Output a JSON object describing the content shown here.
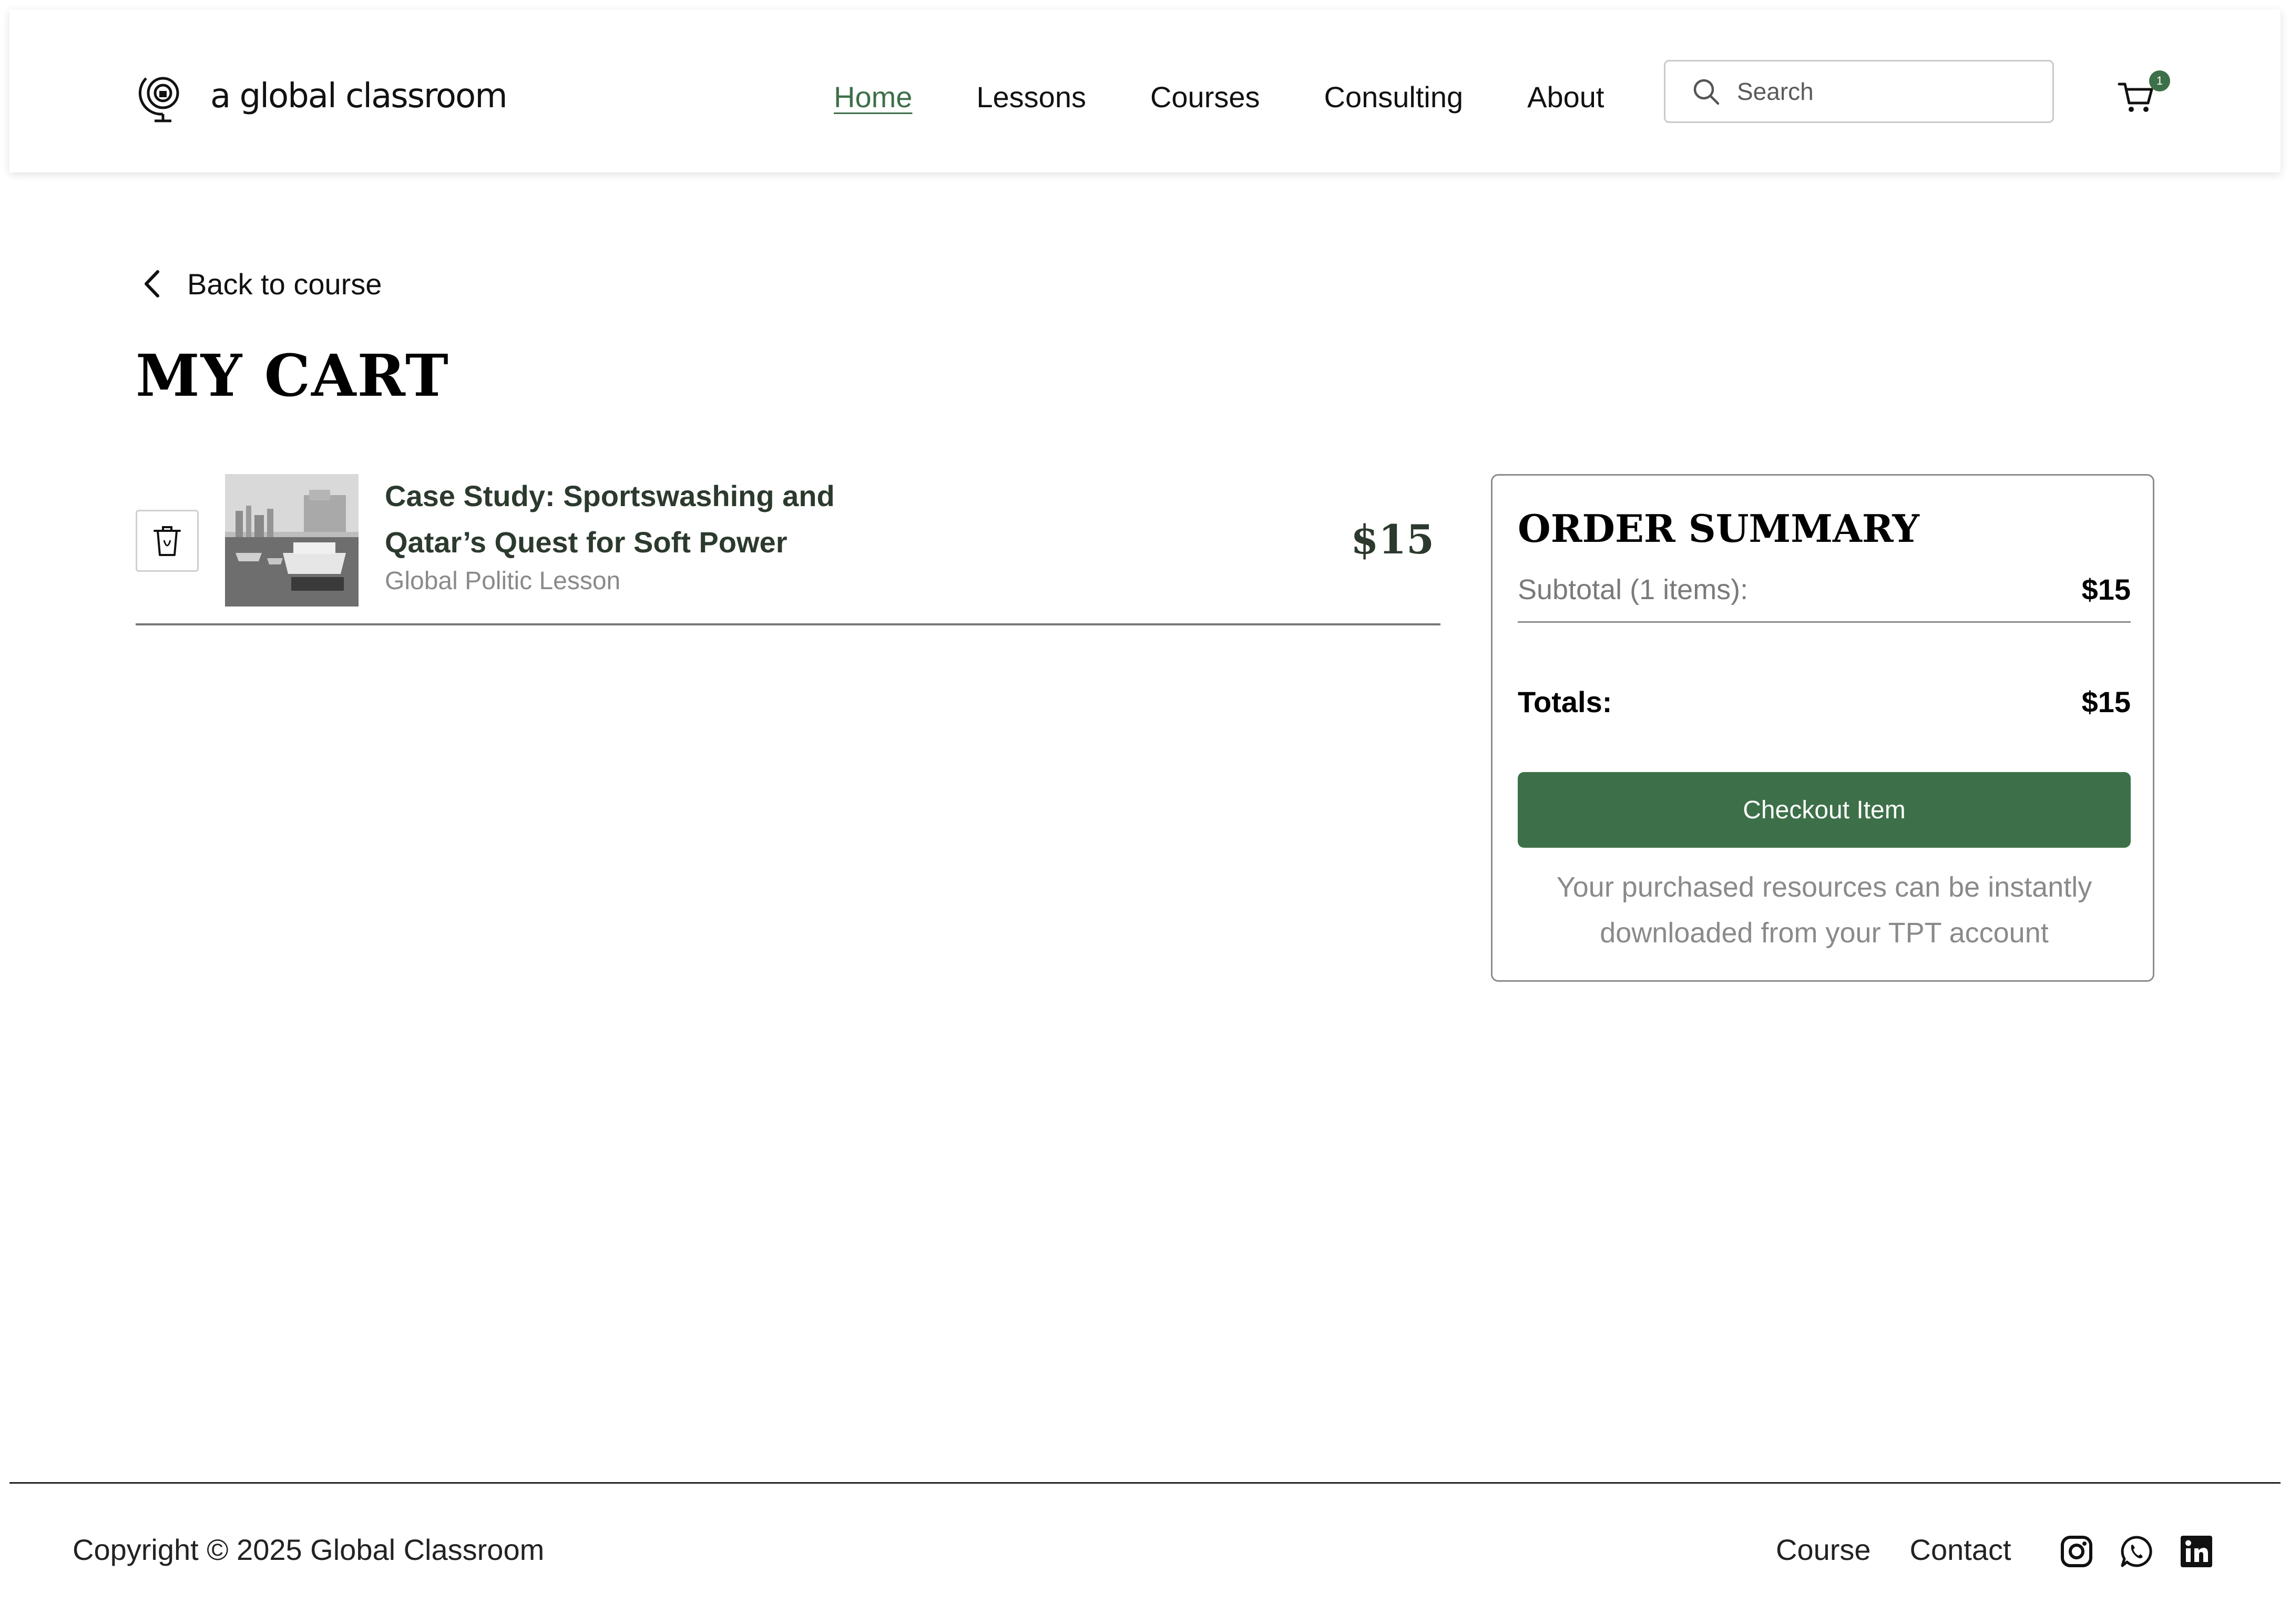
{
  "header": {
    "logo_text": "a global classroom",
    "nav": [
      {
        "label": "Home",
        "active": true
      },
      {
        "label": "Lessons",
        "active": false
      },
      {
        "label": "Courses",
        "active": false
      },
      {
        "label": "Consulting",
        "active": false
      },
      {
        "label": "About",
        "active": false
      }
    ],
    "search_placeholder": "Search",
    "cart_count": "1"
  },
  "back_link": "Back to course",
  "page_title": "MY CART",
  "cart_items": [
    {
      "title": "Case Study: Sportswashing and Qatar’s Quest for Soft Power",
      "subtitle": "Global Politic Lesson",
      "price": "$15"
    }
  ],
  "summary": {
    "title": "ORDER SUMMARY",
    "subtotal_label": "Subtotal (1 items):",
    "subtotal_value": "$15",
    "total_label": "Totals:",
    "total_value": "$15",
    "checkout_label": "Checkout Item",
    "note": "Your purchased resources can be instantly downloaded from your TPT account"
  },
  "footer": {
    "copyright": "Copyright © 2025 Global Classroom",
    "links": [
      "Course",
      "Contact"
    ],
    "social": [
      "instagram-icon",
      "whatsapp-icon",
      "linkedin-icon"
    ]
  },
  "colors": {
    "accent": "#3d7048",
    "text": "#111111",
    "muted": "#8a8a8a"
  }
}
